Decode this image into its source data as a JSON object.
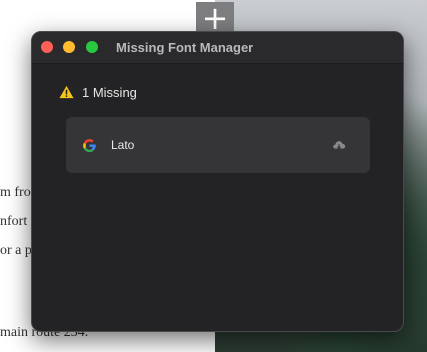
{
  "background": {
    "plus_glyph": "+",
    "text_lines": [
      "m fro",
      "nfort",
      "or a p",
      "main route 234."
    ]
  },
  "window": {
    "title": "Missing Font Manager",
    "controls": {
      "close": "close",
      "minimize": "minimize",
      "zoom": "zoom"
    },
    "missing": {
      "icon": "warning-icon",
      "count_label": "1 Missing"
    },
    "fonts": [
      {
        "source_icon": "google-icon",
        "name": "Lato",
        "action_icon": "cloud-download-icon"
      }
    ]
  },
  "colors": {
    "window_bg": "#232325",
    "card_bg": "#353538",
    "warning": "#f5c518",
    "close": "#fe5f57",
    "minimize": "#febc2e",
    "zoom": "#28c840"
  }
}
